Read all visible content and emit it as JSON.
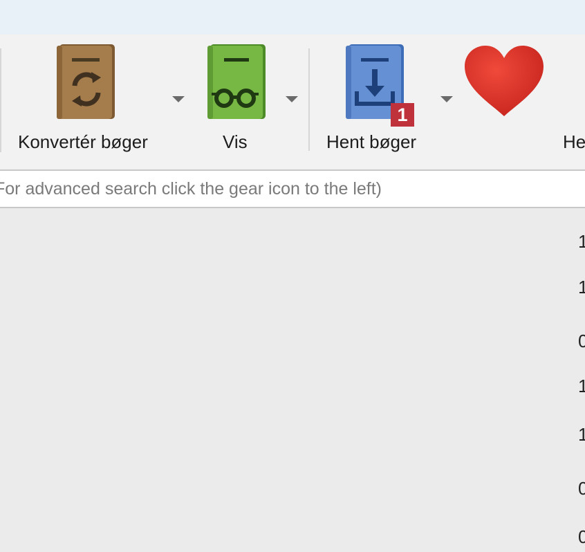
{
  "toolbar": {
    "convert_label": "Konvertér bøger",
    "view_label": "Vis",
    "fetch_label": "Hent bøger",
    "fetch_badge": "1",
    "donate_label_partial": "He"
  },
  "search": {
    "placeholder": "For advanced search click the gear icon to the left)"
  },
  "table": {
    "column_partial_values": [
      "1",
      "1",
      "0",
      "1",
      "1",
      "0",
      "0"
    ]
  },
  "colors": {
    "convert_book": "#a07a4a",
    "view_book": "#6fae3e",
    "fetch_book": "#5b86c8",
    "heart": "#d6332b",
    "badge": "#c0323b"
  }
}
